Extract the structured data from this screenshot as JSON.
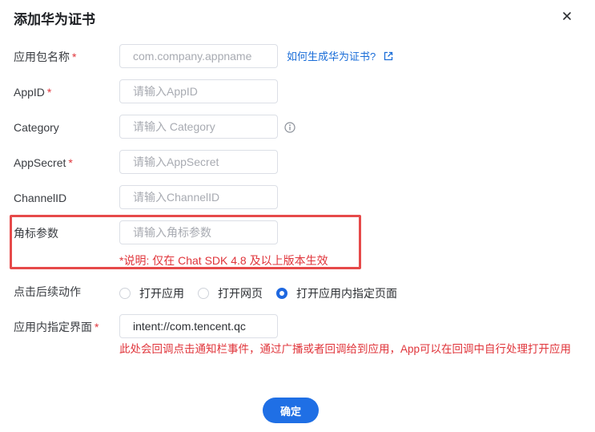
{
  "dialog": {
    "title": "添加华为证书",
    "close_icon": "close-icon"
  },
  "fields": {
    "package_name": {
      "label": "应用包名称",
      "required": "*",
      "placeholder": "com.company.appname",
      "help_link": "如何生成华为证书?"
    },
    "app_id": {
      "label": "AppID",
      "required": "*",
      "placeholder": "请输入AppID"
    },
    "category": {
      "label": "Category",
      "placeholder": "请输入 Category",
      "icon": "info-icon"
    },
    "app_secret": {
      "label": "AppSecret",
      "required": "*",
      "placeholder": "请输入AppSecret"
    },
    "channel_id": {
      "label": "ChannelID",
      "placeholder": "请输入ChannelID"
    },
    "badge_param": {
      "label": "角标参数",
      "placeholder": "请输入角标参数",
      "note": "*说明: 仅在 Chat SDK 4.8 及以上版本生效"
    },
    "click_action": {
      "label": "点击后续动作",
      "options": [
        "打开应用",
        "打开网页",
        "打开应用内指定页面"
      ],
      "selected": "打开应用内指定页面"
    },
    "in_app_page": {
      "label": "应用内指定界面",
      "required": "*",
      "value": "intent://com.tencent.qc",
      "warning": "此处会回调点击通知栏事件，通过广播或者回调给到应用，App可以在回调中自行处理打开应用"
    }
  },
  "actions": {
    "confirm_label": "确定"
  },
  "colors": {
    "primary": "#1f6fe5",
    "danger": "#e0353b",
    "link": "#1a6dd8",
    "highlight_border": "#e64a4a"
  }
}
